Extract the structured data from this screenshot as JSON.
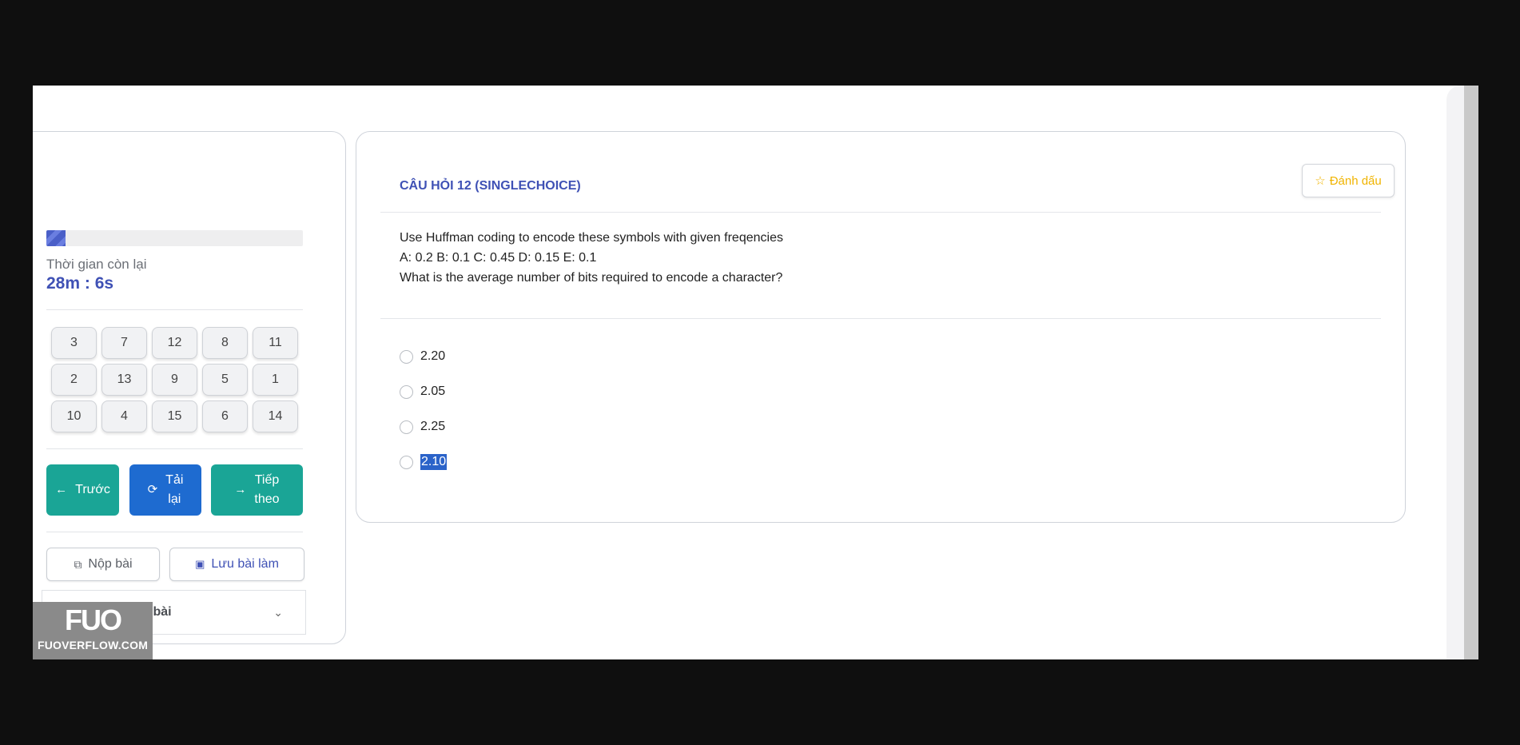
{
  "timer": {
    "label": "Thời gian còn lại",
    "value": "28m : 6s",
    "progress_fraction": 0.075
  },
  "question_grid": [
    "3",
    "7",
    "12",
    "8",
    "11",
    "2",
    "13",
    "9",
    "5",
    "1",
    "10",
    "4",
    "15",
    "6",
    "14"
  ],
  "nav": {
    "prev_label": "Trước",
    "reload_label_1": "Tải",
    "reload_label_2": "lại",
    "next_label_1": "Tiếp",
    "next_label_2": "theo"
  },
  "actions": {
    "submit_label": "Nộp bài",
    "save_label": "Lưu bài làm"
  },
  "notes": {
    "label": "Lưu ý khi làm bài"
  },
  "watermark": {
    "logo": "FUO",
    "text": "FUOVERFLOW.COM"
  },
  "question": {
    "title": "CÂU HỎI 12 (SINGLECHOICE)",
    "mark_label": "Đánh dấu",
    "line1": "Use Huffman coding to encode these symbols with given freqencies",
    "line2": "A: 0.2 B: 0.1 C: 0.45 D: 0.15 E: 0.1",
    "line3": "What is the average number of bits required to encode a character?",
    "options": [
      "2.20",
      "2.05",
      "2.25",
      "2.10"
    ]
  }
}
